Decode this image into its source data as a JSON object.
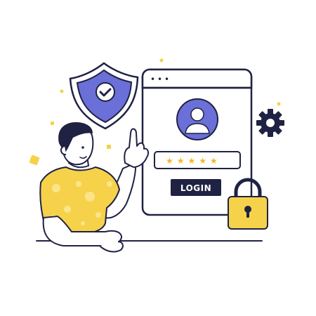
{
  "login_window": {
    "button_label": "LOGIN",
    "password_mask": "★★★★★",
    "dots": [
      "•",
      "•",
      "•"
    ]
  },
  "colors": {
    "outline": "#1f2243",
    "accent": "#6b6fd8",
    "accent_dark": "#5358c6",
    "yellow": "#f6d24a",
    "yellow_light": "#fbe58a",
    "skin": "#ffffff",
    "hair": "#1f2243",
    "gear": "#1f2243",
    "button_bg": "#1f2243",
    "button_text": "#ffffff"
  },
  "icons": {
    "shield": "shield-check-icon",
    "user": "user-avatar-icon",
    "gear": "gear-icon",
    "lock": "padlock-icon"
  }
}
